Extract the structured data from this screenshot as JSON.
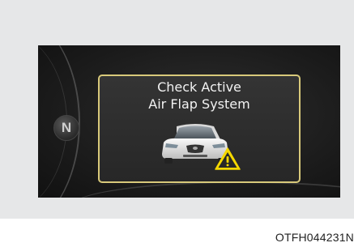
{
  "display": {
    "gear_indicator": "N",
    "message_line1": "Check Active",
    "message_line2": "Air Flap System"
  },
  "icons": {
    "vehicle": "car-front-icon",
    "warning": "warning-triangle-icon"
  },
  "colors": {
    "panel_background": "#1c1c1c",
    "box_border": "#d8c97a",
    "warning_yellow": "#f5d800",
    "text": "#f2f2f2"
  },
  "figure_code": "OTFH044231N"
}
